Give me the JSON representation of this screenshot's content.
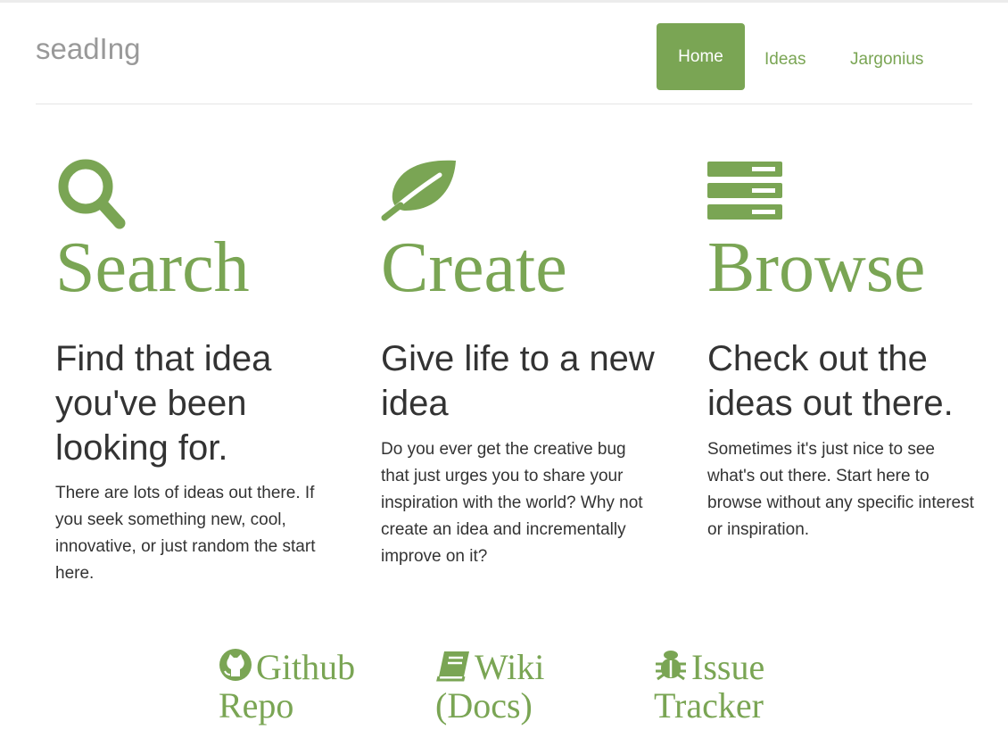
{
  "colors": {
    "accent": "#7aa554",
    "text": "#333333",
    "brand": "#999999",
    "divider": "#e5e5e5"
  },
  "header": {
    "brand": "seadIng",
    "nav": [
      {
        "label": "Home",
        "active": true
      },
      {
        "label": "Ideas",
        "active": false
      },
      {
        "label": "Jargonius",
        "active": false
      }
    ]
  },
  "features": [
    {
      "icon": "search-icon",
      "title": "Search",
      "subtitle": "Find that idea you've been looking for.",
      "text": "There are lots of ideas out there. If you seek something new, cool, innovative, or just random the start here."
    },
    {
      "icon": "leaf-icon",
      "title": "Create",
      "subtitle": "Give life to a new idea",
      "text": "Do you ever get the creative bug that just urges you to share your inspiration with the world? Why not create an idea and incrementally improve on it?"
    },
    {
      "icon": "server-icon",
      "title": "Browse",
      "subtitle": "Check out the ideas out there.",
      "text": "Sometimes it's just nice to see what's out there. Start here to browse without any specific interest or inspiration."
    }
  ],
  "links": [
    {
      "icon": "github-icon",
      "label": "Github Repo"
    },
    {
      "icon": "book-icon",
      "label": "Wiki (Docs)"
    },
    {
      "icon": "bug-icon",
      "label": "Issue Tracker"
    }
  ]
}
